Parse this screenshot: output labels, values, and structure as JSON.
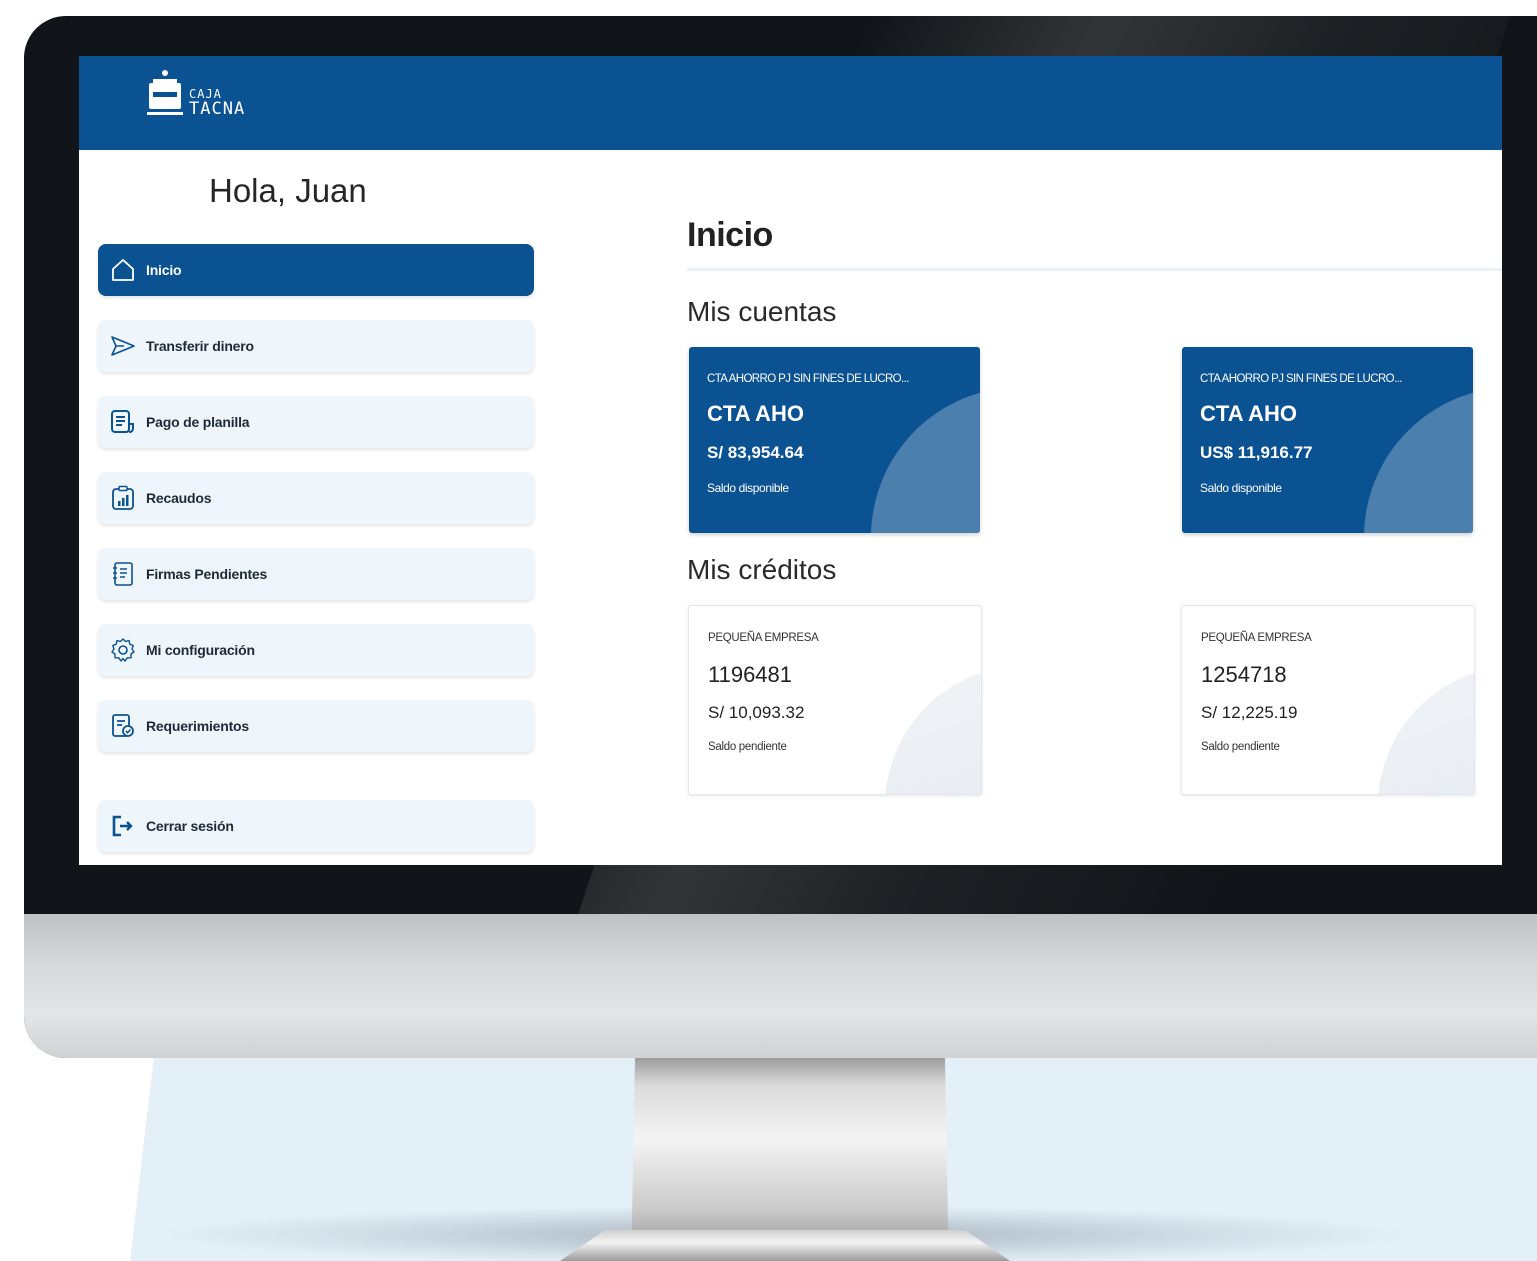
{
  "brand": {
    "line1": "CAJA",
    "line2": "TACNA",
    "primary_color": "#0b5292",
    "accent_color": "#4a7fae"
  },
  "greeting": "Hola, Juan",
  "sidebar": {
    "items": [
      {
        "label": "Inicio",
        "icon": "home-icon",
        "active": true
      },
      {
        "label": "Transferir dinero",
        "icon": "send-icon",
        "active": false
      },
      {
        "label": "Pago de planilla",
        "icon": "document-icon",
        "active": false
      },
      {
        "label": "Recaudos",
        "icon": "chart-report-icon",
        "active": false
      },
      {
        "label": "Firmas Pendientes",
        "icon": "notebook-icon",
        "active": false
      },
      {
        "label": "Mi configuración",
        "icon": "gear-icon",
        "active": false
      },
      {
        "label": "Requerimientos",
        "icon": "request-form-icon",
        "active": false
      }
    ],
    "logout": {
      "label": "Cerrar sesión",
      "icon": "logout-icon"
    }
  },
  "main": {
    "title": "Inicio",
    "accounts_title": "Mis cuentas",
    "accounts": [
      {
        "type": "CTA AHORRO PJ SIN FINES DE LUCRO...",
        "name": "CTA AHO",
        "amount": "S/ 83,954.64",
        "caption": "Saldo disponible"
      },
      {
        "type": "CTA AHORRO PJ SIN FINES DE LUCRO...",
        "name": "CTA AHO",
        "amount": "US$ 11,916.77",
        "caption": "Saldo disponible"
      }
    ],
    "credits_title": "Mis créditos",
    "credits": [
      {
        "type": "PEQUEÑA EMPRESA",
        "number": "1196481",
        "amount": "S/ 10,093.32",
        "caption": "Saldo pendiente"
      },
      {
        "type": "PEQUEÑA EMPRESA",
        "number": "1254718",
        "amount": "S/ 12,225.19",
        "caption": "Saldo pendiente"
      }
    ]
  }
}
